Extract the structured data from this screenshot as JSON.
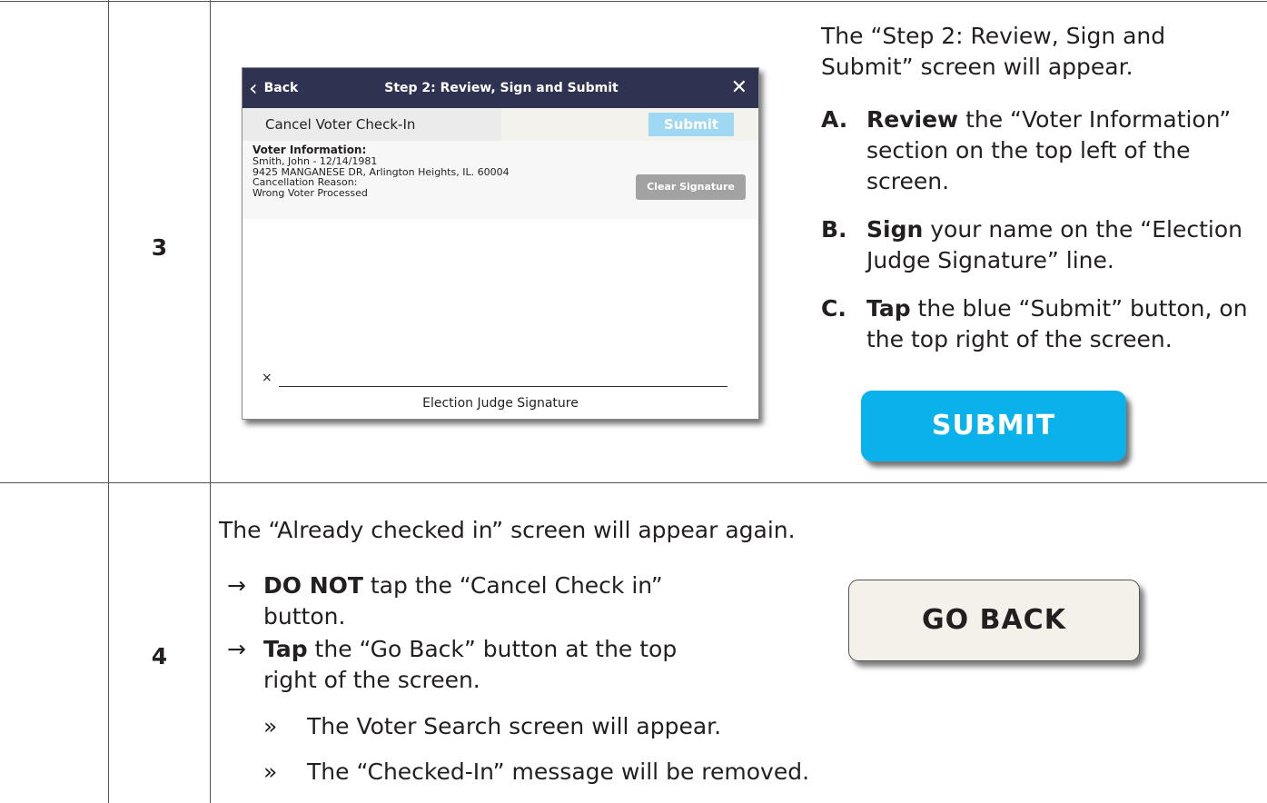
{
  "rows": [
    {
      "number": "3",
      "device": {
        "back_label": "Back",
        "back_icon": "chevron-left-icon",
        "title": "Step 2: Review, Sign and Submit",
        "close_icon": "close-icon",
        "close_glyph": "✕",
        "cancel_label": "Cancel Voter Check-In",
        "submit_label": "Submit",
        "voter_info_heading": "Voter Information:",
        "voter_info_lines": [
          "Smith, John - 12/14/1981",
          "9425 MANGANESE DR, Arlington Heights, IL. 60004",
          "Cancellation Reason:",
          "Wrong Voter Processed"
        ],
        "clear_signature_label": "Clear Signature",
        "signature_x": "×",
        "signature_label": "Election Judge Signature",
        "colors": {
          "header": "#2f3251",
          "submit": "#9fd8f2",
          "clear": "#a2a2a2"
        }
      },
      "intro": "The “Step 2: Review, Sign and Submit” screen will appear.",
      "steps": [
        {
          "letter": "A.",
          "verb": "Review",
          "text": " the “Voter Information” section on the top left of the screen."
        },
        {
          "letter": "B.",
          "verb": "Sign",
          "text": " your name on the “Election Judge Signature” line."
        },
        {
          "letter": "C.",
          "verb": "Tap",
          "text": " the blue “Submit” button, on the top right of the screen."
        }
      ],
      "button": {
        "label": "SUBMIT",
        "color": "#0ab1ea"
      }
    },
    {
      "number": "4",
      "intro": "The “Already checked in” screen will appear again.",
      "arrow": "→",
      "steps": [
        {
          "verb": "DO NOT",
          "text": " tap the “Cancel Check in” button."
        },
        {
          "verb": "Tap",
          "text": " the “Go Back” button at the top right of the screen."
        }
      ],
      "sub_bullet": "»",
      "sub_items": [
        "The Voter Search screen will appear.",
        "The “Checked-In” message will be removed."
      ],
      "button": {
        "label": "GO BACK",
        "color": "#f4f1ea"
      }
    }
  ]
}
